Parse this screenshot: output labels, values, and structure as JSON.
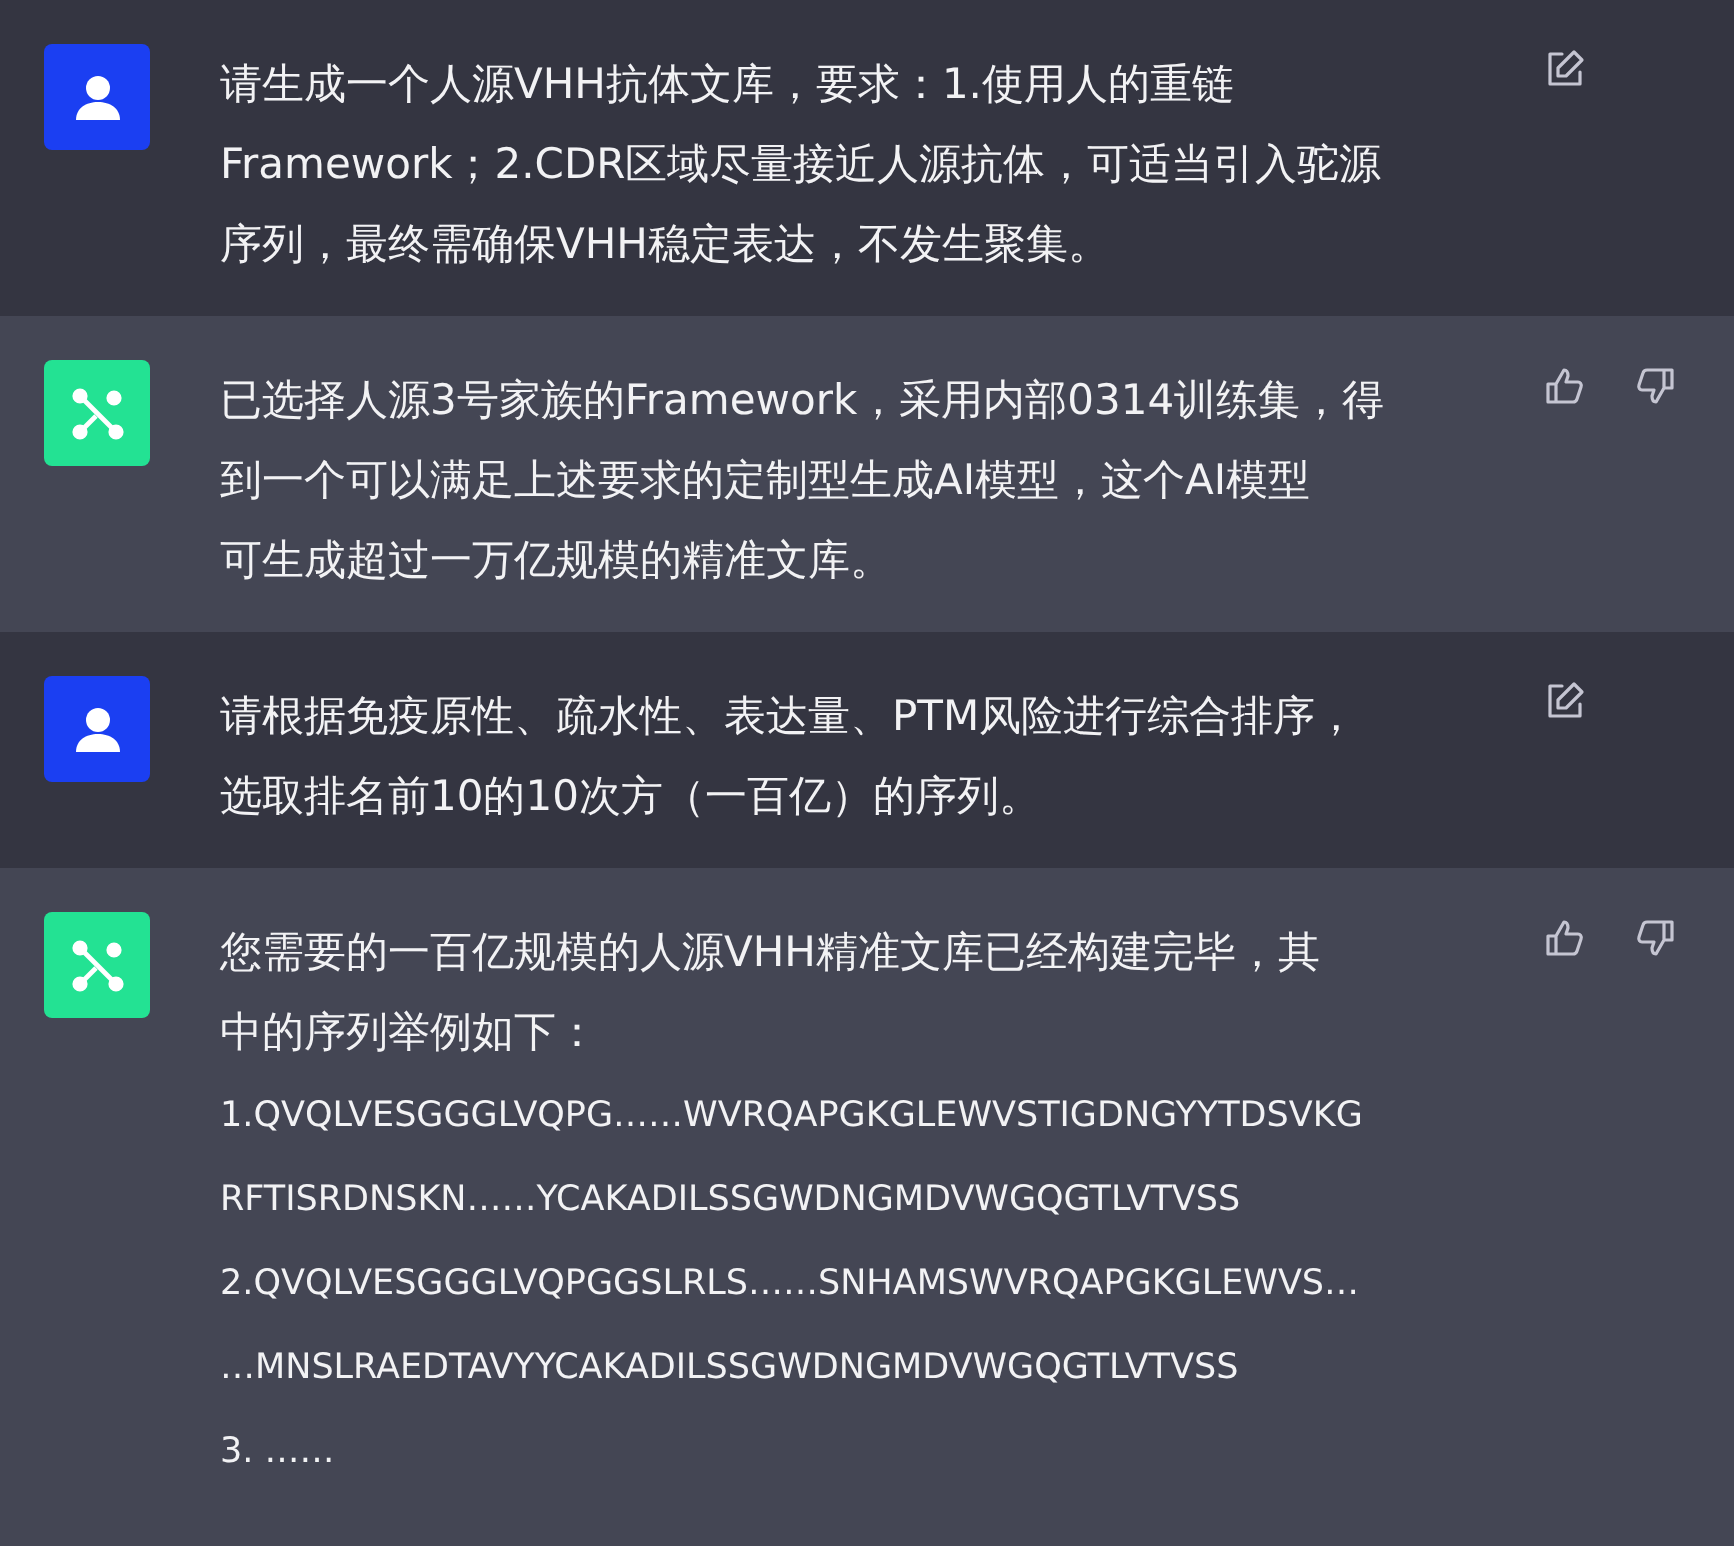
{
  "messages": [
    {
      "kind": "user",
      "lines": [
        "请生成一个人源VHH抗体文库，要求：1.使用人的重链",
        "Framework；2.CDR区域尽量接近人源抗体，可适当引入驼源",
        "序列，最终需确保VHH稳定表达，不发生聚集。"
      ]
    },
    {
      "kind": "assistant",
      "lines": [
        "已选择人源3号家族的Framework，采用内部0314训练集，得",
        "到一个可以满足上述要求的定制型生成AI模型，这个AI模型",
        "可生成超过一万亿规模的精准文库。"
      ]
    },
    {
      "kind": "user",
      "lines": [
        "请根据免疫原性、疏水性、表达量、PTM风险进行综合排序，",
        "选取排名前10的10次方（一百亿）的序列。"
      ]
    },
    {
      "kind": "assistant",
      "lines": [
        "您需要的一百亿规模的人源VHH精准文库已经构建完毕，其",
        "中的序列举例如下："
      ],
      "sequences": [
        "1.QVQLVESGGGLVQPG……WVRQAPGKGLEWVSTIGDNGYYTDSVKG",
        "RFTISRDNSKN……YCAKADILSSGWDNGMDVWGQGTLVTVSS",
        "2.QVQLVESGGGLVQPGGSLRLS……SNHAMSWVRQAPGKGLEWVS…",
        "…MNSLRAEDTAVYYCAKADILSSGWDNGMDVWGQGTLVTVSS",
        "3. ……"
      ]
    }
  ]
}
